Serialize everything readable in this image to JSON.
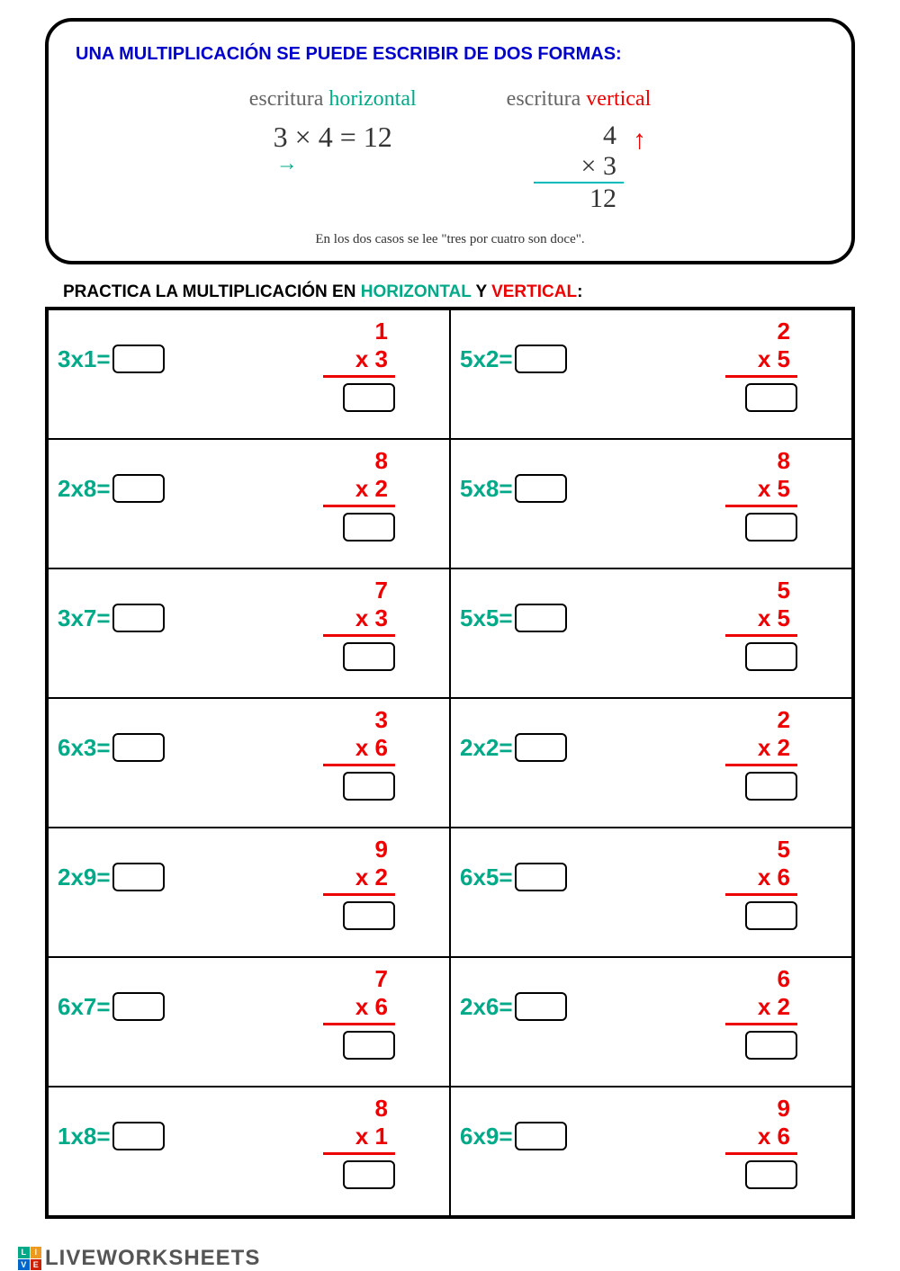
{
  "explain": {
    "title": "UNA MULTIPLICACIÓN SE PUEDE ESCRIBIR DE DOS FORMAS:",
    "horizontal_label_prefix": "escritura ",
    "horizontal_label_word": "horizontal",
    "vertical_label_prefix": "escritura ",
    "vertical_label_word": "vertical",
    "horizontal_example": "3 × 4 = 12",
    "vertical_top": "4",
    "vertical_mult": "×   3",
    "vertical_result": "12",
    "footnote": "En los dos casos se lee \"tres por cuatro son doce\"."
  },
  "practice": {
    "title_prefix": "PRACTICA LA MULTIPLICACIÓN EN ",
    "title_h": "HORIZONTAL",
    "title_mid": " Y ",
    "title_v": "VERTICAL",
    "title_end": ":"
  },
  "cells": [
    {
      "expr": "3x1=",
      "n1": "1",
      "n2": "x 3"
    },
    {
      "expr": "5x2=",
      "n1": "2",
      "n2": "x 5"
    },
    {
      "expr": "2x8=",
      "n1": "8",
      "n2": "x 2"
    },
    {
      "expr": "5x8=",
      "n1": "8",
      "n2": "x 5"
    },
    {
      "expr": "3x7=",
      "n1": "7",
      "n2": "x 3"
    },
    {
      "expr": "5x5=",
      "n1": "5",
      "n2": "x 5"
    },
    {
      "expr": "6x3=",
      "n1": "3",
      "n2": "x 6"
    },
    {
      "expr": "2x2=",
      "n1": "2",
      "n2": "x 2"
    },
    {
      "expr": "2x9=",
      "n1": "9",
      "n2": "x 2"
    },
    {
      "expr": "6x5=",
      "n1": "5",
      "n2": "x 6"
    },
    {
      "expr": "6x7=",
      "n1": "7",
      "n2": "x 6"
    },
    {
      "expr": "2x6=",
      "n1": "6",
      "n2": "x 2"
    },
    {
      "expr": "1x8=",
      "n1": "8",
      "n2": "x 1"
    },
    {
      "expr": "6x9=",
      "n1": "9",
      "n2": "x 6"
    }
  ],
  "footer": "LIVEWORKSHEETS"
}
